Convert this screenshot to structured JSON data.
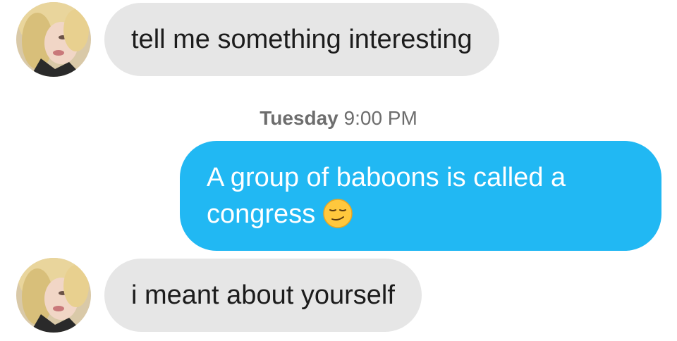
{
  "messages": [
    {
      "from": "match",
      "text": "tell me something interesting"
    },
    {
      "from": "me",
      "line1": "A group of baboons is called a",
      "line2": "congress",
      "emoji": "smirk-face-icon"
    },
    {
      "from": "match",
      "text": "i meant about yourself"
    }
  ],
  "timestamp": {
    "day": "Tuesday",
    "time": "9:00 PM"
  },
  "colors": {
    "incoming_bubble": "#e6e6e6",
    "outgoing_bubble": "#21b8f3",
    "timestamp_text": "#6d6d6d"
  }
}
